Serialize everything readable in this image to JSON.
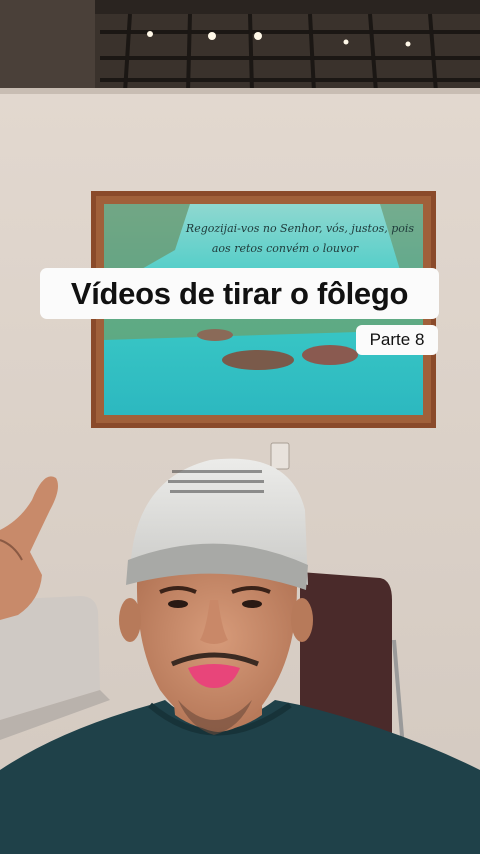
{
  "overlay": {
    "caption": "Vídeos de tirar o fôlego",
    "part_label": "Parte 8"
  },
  "painting": {
    "inscription_line1": "Regozijai-vos no Senhor, vós, justos, pois",
    "inscription_line2": "aos retos convém o louvor"
  },
  "colors": {
    "wall": "#ddd3ca",
    "frame_wood": "#8a4a2a",
    "water": "#39c6c4",
    "cap": "#d8d8d6",
    "shirt": "#1f4149",
    "caption_bg": "#fbfbfb"
  }
}
